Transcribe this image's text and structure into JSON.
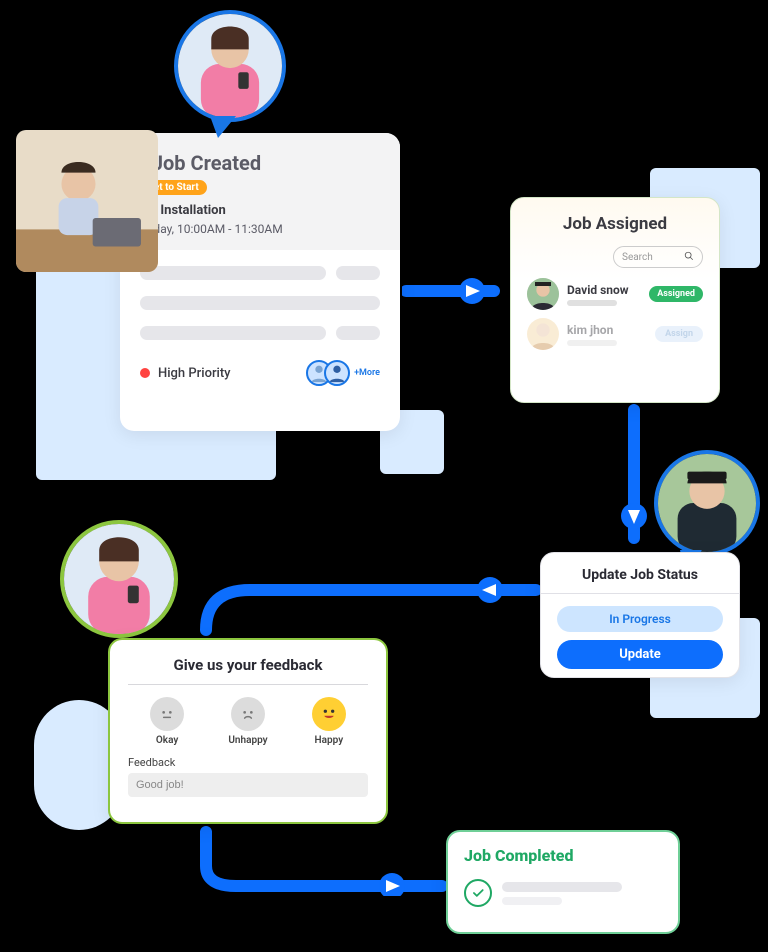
{
  "job_created": {
    "title": "#Job Created",
    "status_badge": "Yet to Start",
    "service": "AC Installation",
    "schedule": "Today, 10:00AM - 11:30AM",
    "priority": "High Priority",
    "more_label": "+More"
  },
  "job_assigned": {
    "title": "Job Assigned",
    "search_placeholder": "Search",
    "workers": [
      {
        "name": "David snow",
        "status": "Assigned"
      },
      {
        "name": "kim jhon",
        "status": "Assign"
      }
    ]
  },
  "update_status": {
    "title": "Update Job Status",
    "state": "In Progress",
    "action": "Update"
  },
  "feedback": {
    "title": "Give us your feedback",
    "options": [
      {
        "label": "Okay"
      },
      {
        "label": "Unhappy"
      },
      {
        "label": "Happy"
      }
    ],
    "field_label": "Feedback",
    "value": "Good job!"
  },
  "completed": {
    "title": "Job Completed"
  }
}
